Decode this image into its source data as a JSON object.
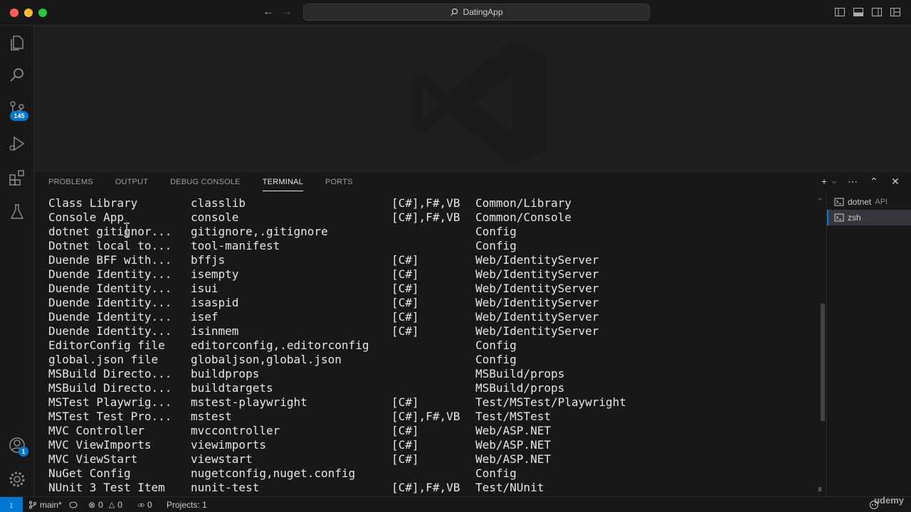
{
  "titlebar": {
    "search_text": "DatingApp",
    "back_icon": "arrow-left-icon",
    "forward_icon": "arrow-right-icon"
  },
  "activitybar": {
    "items": [
      {
        "name": "explorer",
        "icon": "files-icon"
      },
      {
        "name": "search",
        "icon": "search-icon"
      },
      {
        "name": "source-control",
        "icon": "source-control-icon",
        "badge": "145"
      },
      {
        "name": "run-debug",
        "icon": "run-debug-icon"
      },
      {
        "name": "extensions",
        "icon": "extensions-icon"
      },
      {
        "name": "testing",
        "icon": "flask-icon"
      }
    ],
    "accounts_badge": "1"
  },
  "panel": {
    "tabs": [
      {
        "label": "PROBLEMS",
        "active": false
      },
      {
        "label": "OUTPUT",
        "active": false
      },
      {
        "label": "DEBUG CONSOLE",
        "active": false
      },
      {
        "label": "TERMINAL",
        "active": true
      },
      {
        "label": "PORTS",
        "active": false
      }
    ]
  },
  "terminal": {
    "rows": [
      [
        "Class Library",
        "classlib",
        "[C#],F#,VB",
        "Common/Library"
      ],
      [
        "Console App",
        "console",
        "[C#],F#,VB",
        "Common/Console"
      ],
      [
        "dotnet gitignor...",
        "gitignore,.gitignore",
        "",
        "Config"
      ],
      [
        "Dotnet local to...",
        "tool-manifest",
        "",
        "Config"
      ],
      [
        "Duende BFF with...",
        "bffjs",
        "[C#]",
        "Web/IdentityServer"
      ],
      [
        "Duende Identity...",
        "isempty",
        "[C#]",
        "Web/IdentityServer"
      ],
      [
        "Duende Identity...",
        "isui",
        "[C#]",
        "Web/IdentityServer"
      ],
      [
        "Duende Identity...",
        "isaspid",
        "[C#]",
        "Web/IdentityServer"
      ],
      [
        "Duende Identity...",
        "isef",
        "[C#]",
        "Web/IdentityServer"
      ],
      [
        "Duende Identity...",
        "isinmem",
        "[C#]",
        "Web/IdentityServer"
      ],
      [
        "EditorConfig file",
        "editorconfig,.editorconfig",
        "",
        "Config"
      ],
      [
        "global.json file",
        "globaljson,global.json",
        "",
        "Config"
      ],
      [
        "MSBuild Directo...",
        "buildprops",
        "",
        "MSBuild/props"
      ],
      [
        "MSBuild Directo...",
        "buildtargets",
        "",
        "MSBuild/props"
      ],
      [
        "MSTest Playwrig...",
        "mstest-playwright",
        "[C#]",
        "Test/MSTest/Playwright"
      ],
      [
        "MSTest Test Pro...",
        "mstest",
        "[C#],F#,VB",
        "Test/MSTest"
      ],
      [
        "MVC Controller",
        "mvccontroller",
        "[C#]",
        "Web/ASP.NET"
      ],
      [
        "MVC ViewImports",
        "viewimports",
        "[C#]",
        "Web/ASP.NET"
      ],
      [
        "MVC ViewStart",
        "viewstart",
        "[C#]",
        "Web/ASP.NET"
      ],
      [
        "NuGet Config",
        "nugetconfig,nuget.config",
        "",
        "Config"
      ],
      [
        "NUnit 3 Test Item",
        "nunit-test",
        "[C#],F#,VB",
        "Test/NUnit"
      ]
    ]
  },
  "terminal_list": [
    {
      "name": "dotnet",
      "sub": "API",
      "selected": false
    },
    {
      "name": "zsh",
      "sub": "",
      "selected": true
    }
  ],
  "statusbar": {
    "branch": "main*",
    "errors": "0",
    "warnings": "0",
    "ports": "0",
    "projects": "Projects: 1"
  },
  "watermark": "udemy"
}
